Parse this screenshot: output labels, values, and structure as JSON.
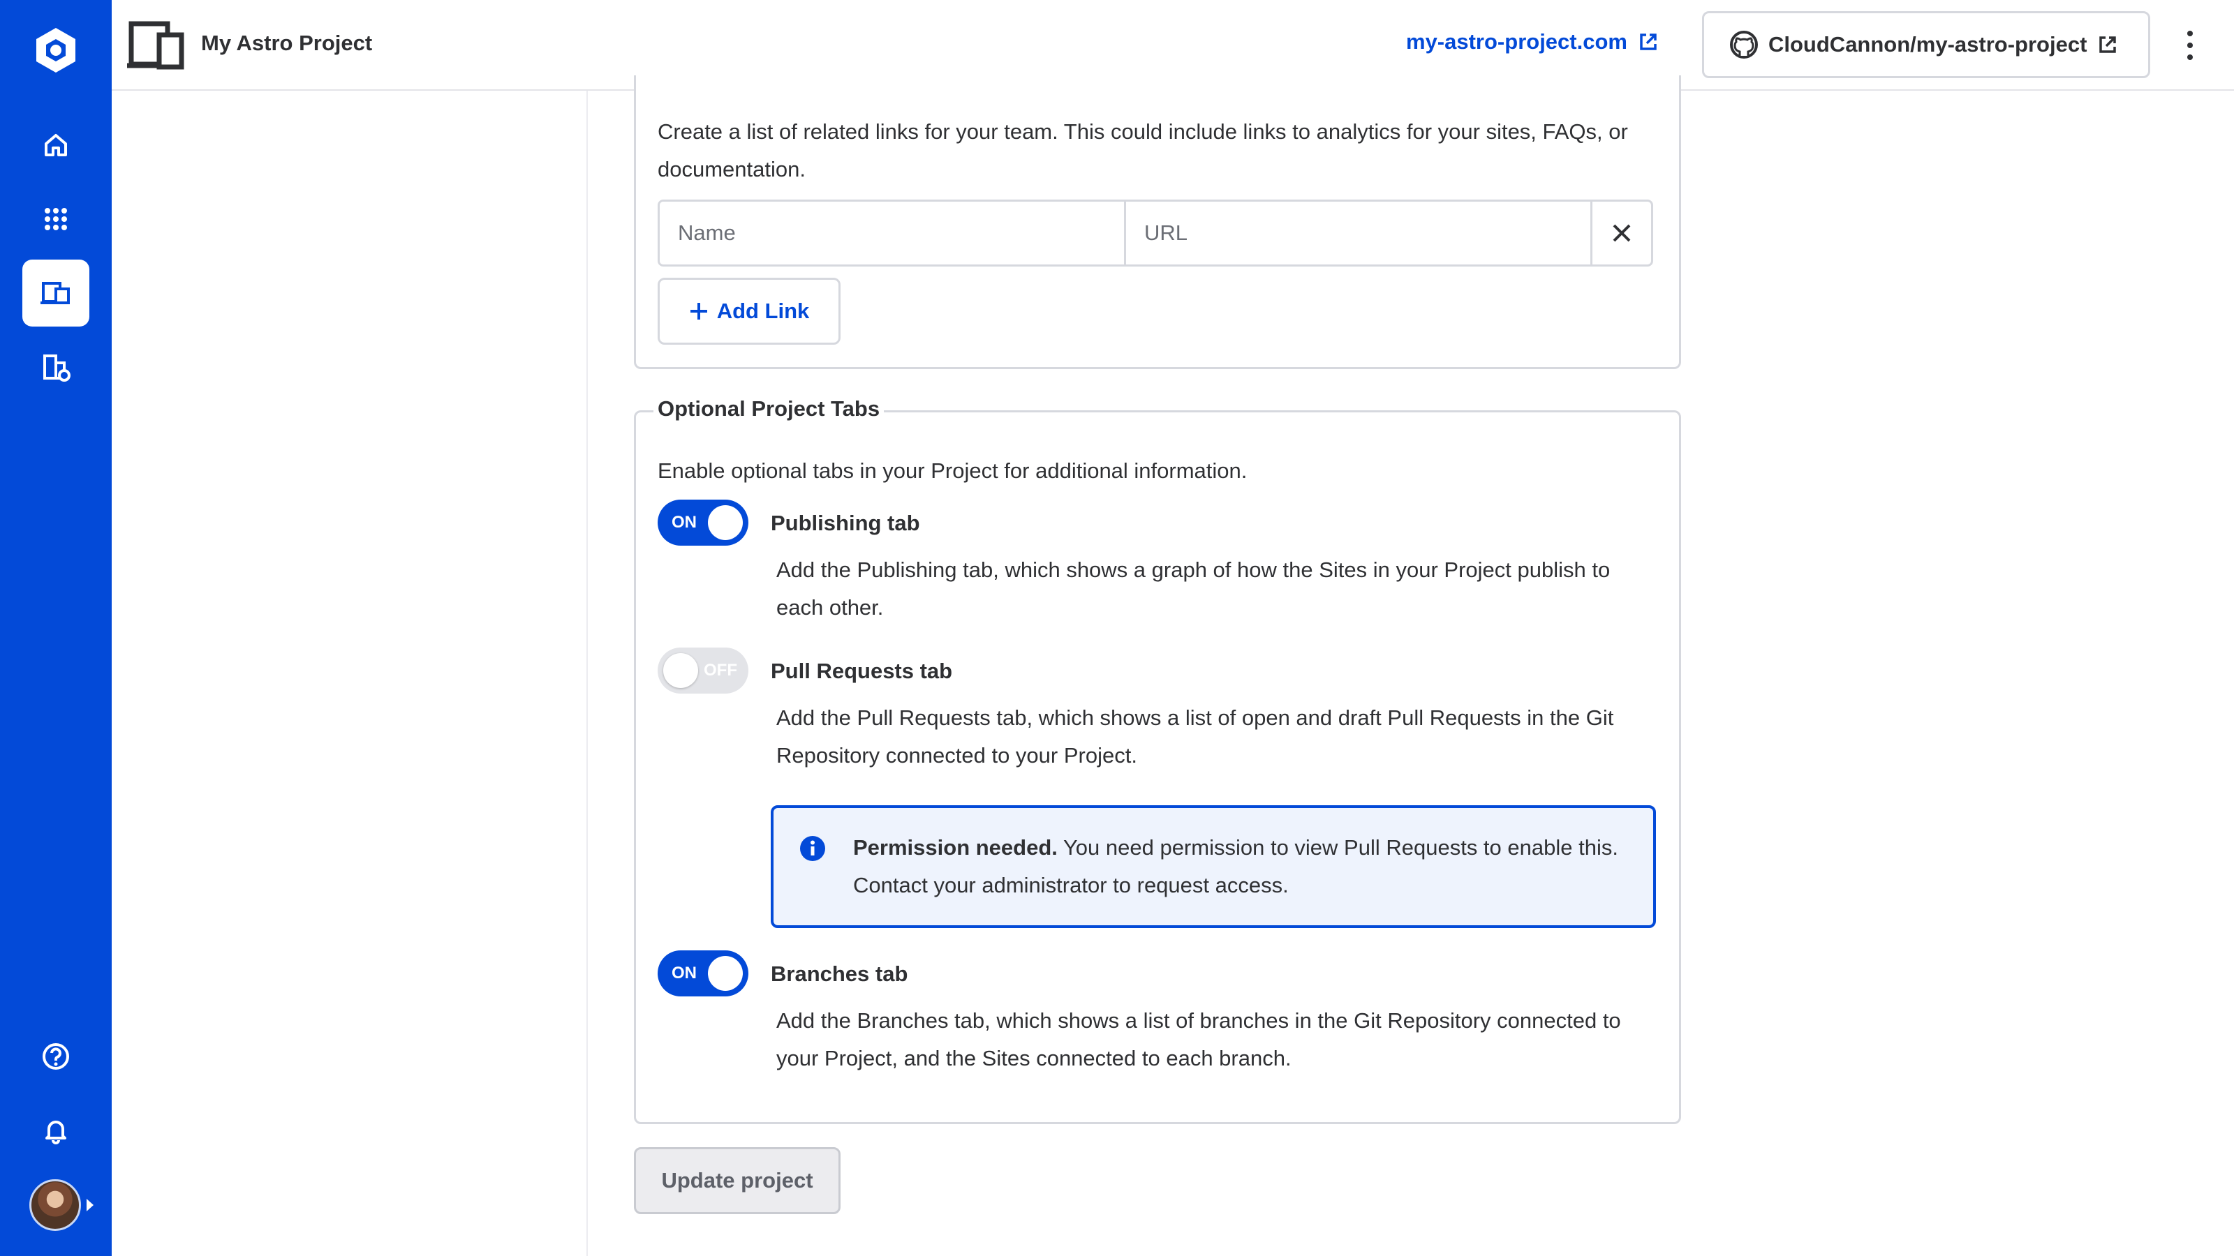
{
  "header": {
    "project_title": "My Astro Project",
    "site_link": "my-astro-project.com",
    "repo_link": "CloudCannon/my-astro-project"
  },
  "links_section": {
    "description": "Create a list of related links for your team. This could include links to analytics for your sites, FAQs, or documentation.",
    "name_placeholder": "Name",
    "url_placeholder": "URL",
    "add_link_label": "Add Link"
  },
  "tabs_section": {
    "legend": "Optional Project Tabs",
    "description": "Enable optional tabs in your Project for additional information.",
    "tabs": [
      {
        "title": "Publishing tab",
        "state": "ON",
        "description": "Add the Publishing tab, which shows a graph of how the Sites in your Project publish to each other."
      },
      {
        "title": "Pull Requests tab",
        "state": "OFF",
        "description": "Add the Pull Requests tab, which shows a list of open and draft Pull Requests in the Git Repository connected to your Project."
      },
      {
        "title": "Branches tab",
        "state": "ON",
        "description": "Add the Branches tab, which shows a list of branches in the Git Repository connected to your Project, and the Sites connected to each branch."
      }
    ],
    "permission_notice": {
      "bold": "Permission needed.",
      "text": "You need permission to view Pull Requests to enable this. Contact your administrator to request access."
    }
  },
  "update_button_label": "Update project",
  "colors": {
    "brand": "#034ad8",
    "border": "#d6d8de",
    "notice_bg": "#eef3fd"
  }
}
